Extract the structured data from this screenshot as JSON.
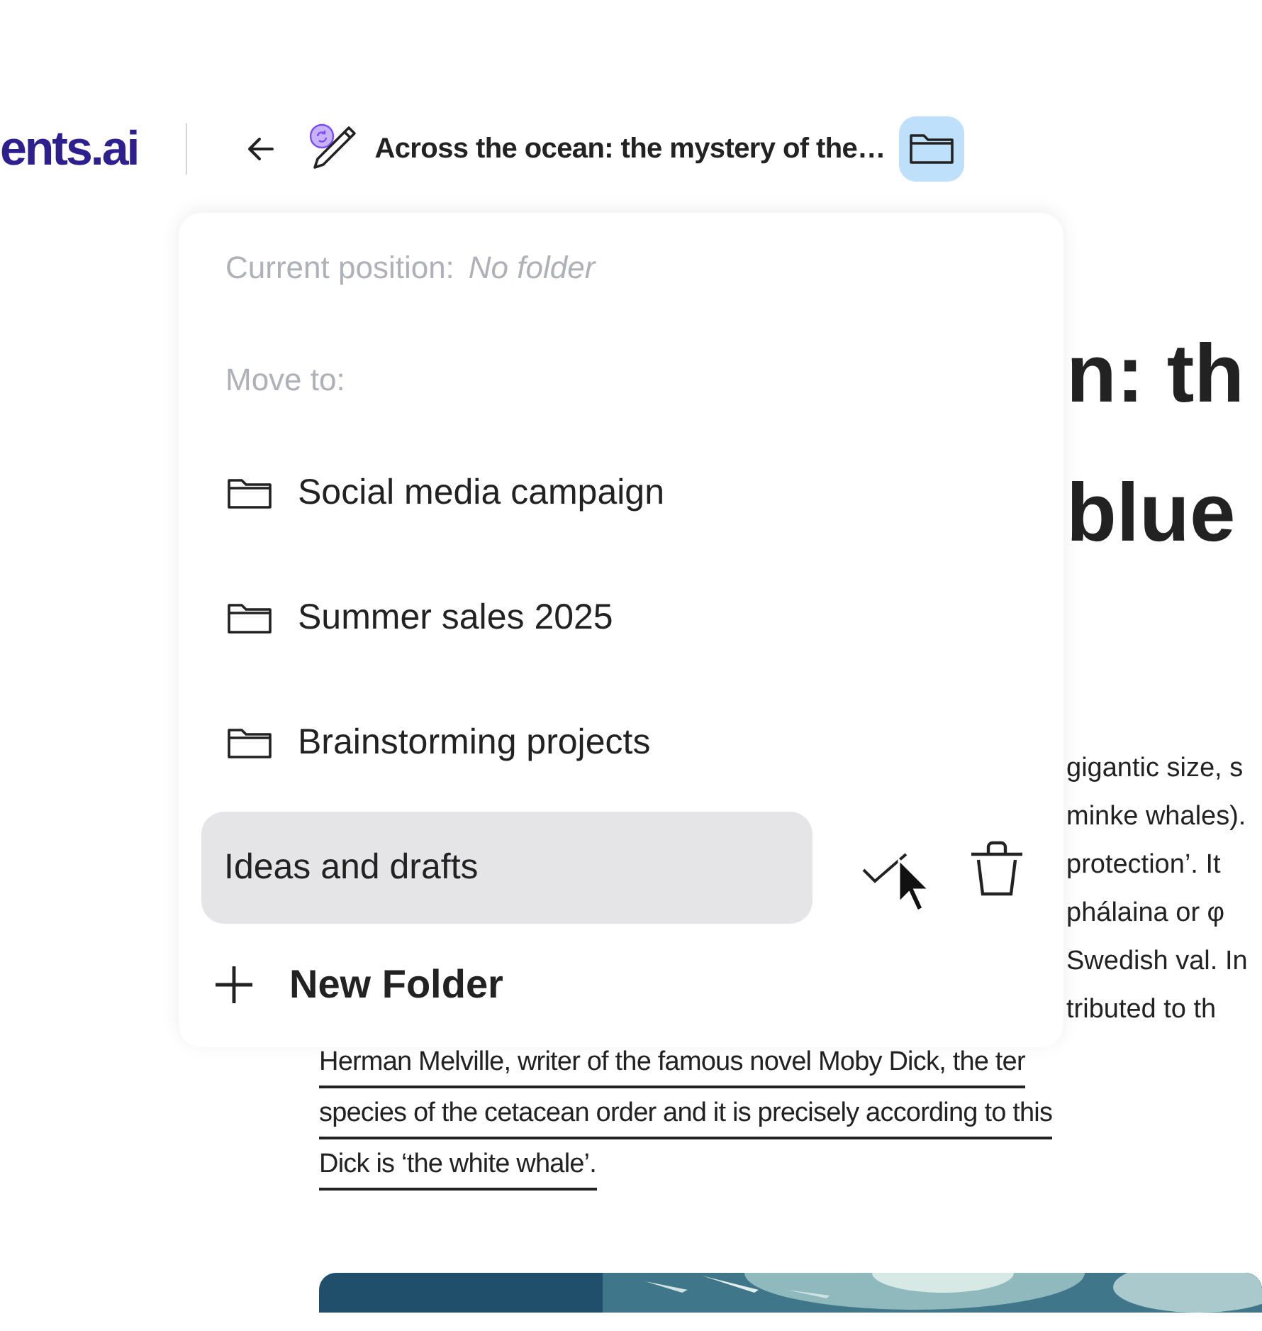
{
  "header": {
    "logo": "ents.ai",
    "title": "Across the ocean: the mystery of the…"
  },
  "article": {
    "heading_fragments": [
      "n: th",
      "blue"
    ],
    "body_fragments": [
      "gigantic size, s",
      "minke whales).",
      "protection’. It",
      "phálaina or φ",
      "Swedish val. In",
      "tributed to th"
    ],
    "linked_lines": [
      "Herman Melville, writer of the famous novel Moby Dick, the ter",
      "species of the cetacean order and it is precisely according to this",
      "Dick is ‘the white whale’."
    ],
    "image": {
      "kind": "picture"
    }
  },
  "folder_menu": {
    "current_label": "Current position:",
    "current_value": "No folder",
    "move_label": "Move to:",
    "folders": [
      {
        "name": "Social media campaign"
      },
      {
        "name": "Summer sales 2025"
      },
      {
        "name": "Brainstorming projects"
      }
    ],
    "rename_field": {
      "value": "Ideas and drafts"
    },
    "new_folder": "New Folder"
  }
}
